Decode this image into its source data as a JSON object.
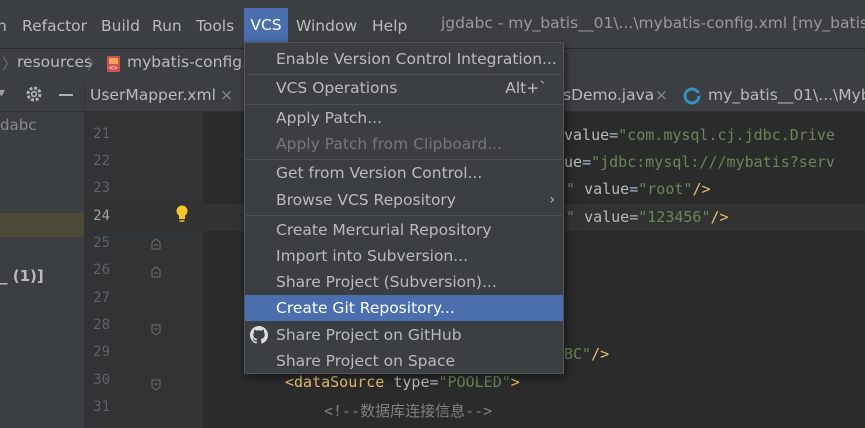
{
  "menubar": {
    "items": [
      {
        "label": "Refactor"
      },
      {
        "label": "Build"
      },
      {
        "label": "Run"
      },
      {
        "label": "Tools"
      },
      {
        "label": "VCS"
      },
      {
        "label": "Window"
      },
      {
        "label": "Help"
      }
    ],
    "window_title": "jgdabc - my_batis__01\\...\\mybatis-config.xml [my_batis__"
  },
  "breadcrumb": {
    "items": [
      {
        "label": "resources"
      },
      {
        "label": "mybatis-config.x"
      }
    ]
  },
  "project_panel": {
    "root_label_partial": "dabc",
    "node_label_partial": "_ (1)]"
  },
  "tabs": [
    {
      "label": "UserMapper.xml"
    },
    {
      "label": "sDemo.java"
    },
    {
      "label": "my_batis__01\\...\\Myb"
    }
  ],
  "gutter": {
    "line_numbers": [
      "21",
      "22",
      "23",
      "24",
      "25",
      "26",
      "27",
      "28",
      "29",
      "30",
      "31"
    ]
  },
  "code": {
    "line21": {
      "attr": "value",
      "eq": "=",
      "str": "\"com.mysql.cj.jdbc.Drive"
    },
    "line22": {
      "attr": "ue",
      "eq": "=",
      "str": "\"jdbc:mysql:///mybatis?serv"
    },
    "line23": {
      "pre": "\" ",
      "attr": "value",
      "eq": "=",
      "str": "\"root\"",
      "end": "/>"
    },
    "line24": {
      "pre": "\" ",
      "attr": "value",
      "eq": "=",
      "str": "\"123456\"",
      "end": "/>"
    },
    "line29": {
      "str": "BC\"",
      "end": "/>"
    },
    "line30": {
      "tag_open": "<dataSource ",
      "attr": "type",
      "eq": "=",
      "str": "\"POOLED\"",
      "tag_close": ">"
    },
    "line31": {
      "comment": "<!--数据库连接信息-->"
    }
  },
  "vcs_menu": {
    "items": [
      {
        "label": "Enable Version Control Integration...",
        "enabled": true
      },
      {
        "label": "VCS Operations",
        "shortcut": "Alt+`",
        "enabled": true
      },
      {
        "label": "Apply Patch...",
        "enabled": true
      },
      {
        "label": "Apply Patch from Clipboard...",
        "enabled": false
      },
      {
        "label": "Get from Version Control...",
        "enabled": true
      },
      {
        "label": "Browse VCS Repository",
        "submenu": true,
        "enabled": true
      },
      {
        "label": "Create Mercurial Repository",
        "enabled": true
      },
      {
        "label": "Import into Subversion...",
        "enabled": true
      },
      {
        "label": "Share Project (Subversion)...",
        "enabled": true
      },
      {
        "label": "Create Git Repository...",
        "enabled": true,
        "selected": true
      },
      {
        "label": "Share Project on GitHub",
        "icon": "github-icon",
        "enabled": true
      },
      {
        "label": "Share Project on Space",
        "enabled": true
      }
    ]
  },
  "colors": {
    "accent": "#4b6eaf",
    "background": "#2b2b2b",
    "panel": "#3c3f41",
    "string": "#6a8759",
    "tag": "#e8bf6a"
  }
}
